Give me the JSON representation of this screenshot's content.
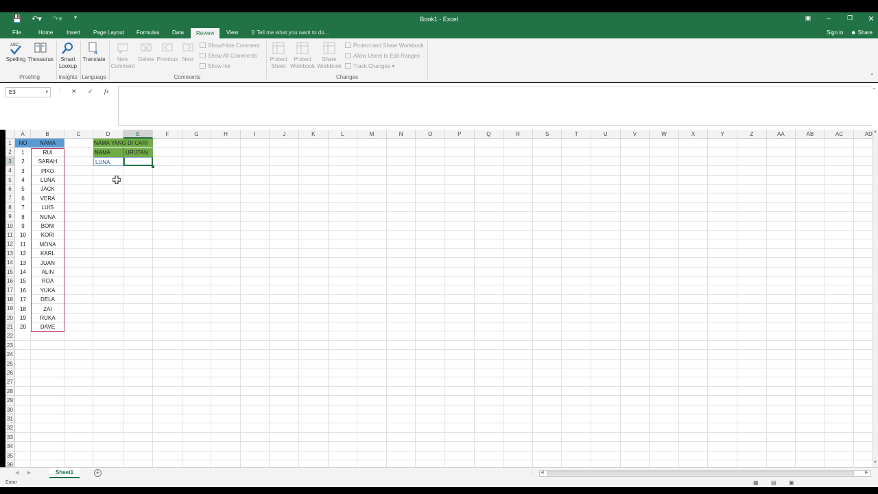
{
  "window": {
    "title": "Book1 - Excel",
    "sign_in": "Sign in",
    "share": "Share"
  },
  "tabs": [
    {
      "label": "File"
    },
    {
      "label": "Home"
    },
    {
      "label": "Insert"
    },
    {
      "label": "Page Layout"
    },
    {
      "label": "Formulas"
    },
    {
      "label": "Data"
    },
    {
      "label": "Review"
    },
    {
      "label": "View"
    }
  ],
  "active_tab": "Review",
  "tell_me": "Tell me what you want to do...",
  "ribbon": {
    "proofing": {
      "label": "Proofing",
      "spelling": "Spelling",
      "spelling_badge": "ABC",
      "thesaurus": "Thesaurus"
    },
    "insights": {
      "label": "Insights",
      "smart": "Smart",
      "lookup": "Lookup"
    },
    "language": {
      "label": "Language",
      "translate": "Translate"
    },
    "comments": {
      "label": "Comments",
      "new1": "New",
      "new2": "Comment",
      "delete": "Delete",
      "previous": "Previous",
      "next": "Next",
      "show_hide": "Show/Hide Comment",
      "show_all": "Show All Comments",
      "show_ink": "Show Ink"
    },
    "changes": {
      "label": "Changes",
      "protect_sheet1": "Protect",
      "protect_sheet2": "Sheet",
      "protect_wb1": "Protect",
      "protect_wb2": "Workbook",
      "share_wb1": "Share",
      "share_wb2": "Workbook",
      "protect_share": "Protect and Share Workbook",
      "allow_users": "Allow Users to Edit Ranges",
      "track_changes": "Track Changes"
    }
  },
  "name_box": "E3",
  "fx": "fx",
  "columns": [
    "A",
    "B",
    "C",
    "D",
    "E",
    "F",
    "G",
    "H",
    "I",
    "J",
    "K",
    "L",
    "M",
    "N",
    "O",
    "P",
    "Q",
    "R",
    "S",
    "T",
    "U",
    "V",
    "W",
    "X",
    "Y",
    "Z",
    "AA",
    "AB",
    "AC",
    "AD"
  ],
  "rows": [
    "1",
    "2",
    "3",
    "4",
    "5",
    "6",
    "7",
    "8",
    "9",
    "10",
    "11",
    "12",
    "13",
    "14",
    "15",
    "16",
    "17",
    "18",
    "19",
    "20",
    "21",
    "22",
    "23",
    "24",
    "25",
    "26",
    "27",
    "28",
    "29",
    "30",
    "31",
    "32",
    "33",
    "34",
    "35",
    "36"
  ],
  "table": {
    "header_no": "NO",
    "header_nama": "NAMA",
    "rows": [
      {
        "no": "1",
        "nama": "RUI"
      },
      {
        "no": "2",
        "nama": "SARAH"
      },
      {
        "no": "3",
        "nama": "PIKO"
      },
      {
        "no": "4",
        "nama": "LUNA"
      },
      {
        "no": "5",
        "nama": "JACK"
      },
      {
        "no": "6",
        "nama": "VERA"
      },
      {
        "no": "7",
        "nama": "LUIS"
      },
      {
        "no": "8",
        "nama": "NUNA"
      },
      {
        "no": "9",
        "nama": "BONI"
      },
      {
        "no": "10",
        "nama": "KORI"
      },
      {
        "no": "11",
        "nama": "MONA"
      },
      {
        "no": "12",
        "nama": "KARL"
      },
      {
        "no": "13",
        "nama": "JUAN"
      },
      {
        "no": "14",
        "nama": "ALIN"
      },
      {
        "no": "15",
        "nama": "ROA"
      },
      {
        "no": "16",
        "nama": "YUKA"
      },
      {
        "no": "17",
        "nama": "DELA"
      },
      {
        "no": "18",
        "nama": "ZAI"
      },
      {
        "no": "19",
        "nama": "RUKA"
      },
      {
        "no": "20",
        "nama": "DAVE"
      }
    ]
  },
  "lookup": {
    "title": "NAMA YANG DI CARI",
    "col_nama": "NAMA",
    "col_urutan": "URUTAN",
    "value_nama": "LUNA",
    "value_urutan": ""
  },
  "sheet_tab": "Sheet1",
  "status": "Enter",
  "colors": {
    "excel_green": "#217346",
    "header_blue": "#5b9bd5",
    "header_green": "#70ad47",
    "table_border": "#c0395a"
  }
}
